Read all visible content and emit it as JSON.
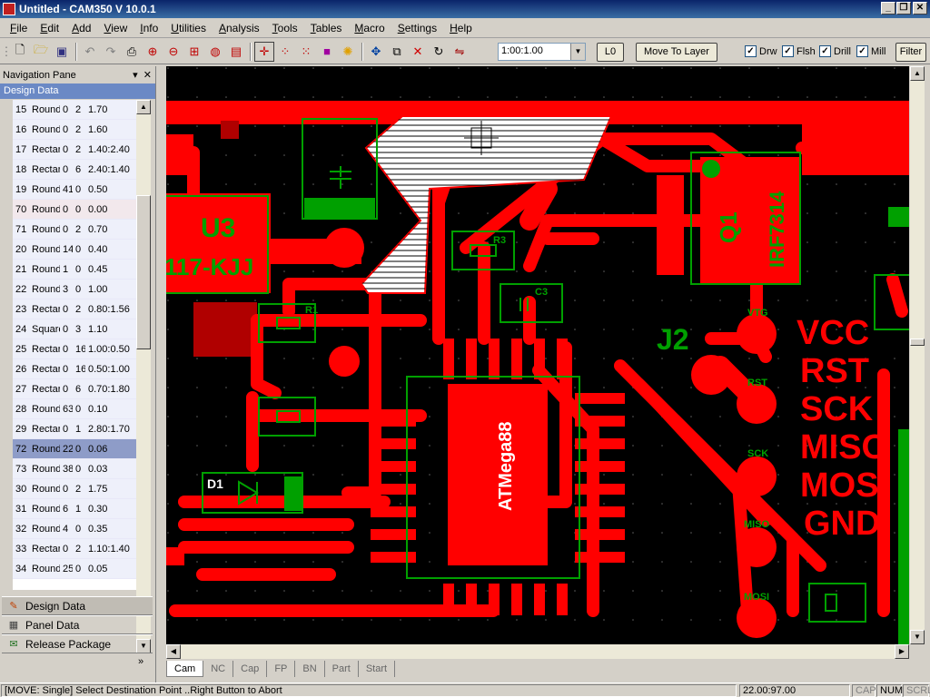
{
  "window": {
    "title": "Untitled - CAM350 V 10.0.1"
  },
  "window_controls": [
    "_",
    "❐",
    "✕"
  ],
  "menu": [
    "File",
    "Edit",
    "Add",
    "View",
    "Info",
    "Utilities",
    "Analysis",
    "Tools",
    "Tables",
    "Macro",
    "Settings",
    "Help"
  ],
  "toolbar": {
    "zoom_value": "1:00:1.00",
    "layer_button": "L0",
    "move_to_layer_button": "Move To Layer",
    "filter_button": "Filter",
    "checkboxes": [
      {
        "label": "Drw",
        "checked": true
      },
      {
        "label": "Flsh",
        "checked": true
      },
      {
        "label": "Drill",
        "checked": true
      },
      {
        "label": "Mill",
        "checked": true
      }
    ]
  },
  "nav_pane": {
    "title": "Navigation Pane",
    "section": "Design Data",
    "apertures": [
      {
        "id": "15",
        "shape": "Round",
        "a": "0",
        "b": "2",
        "size": "1.70"
      },
      {
        "id": "16",
        "shape": "Round",
        "a": "0",
        "b": "2",
        "size": "1.60"
      },
      {
        "id": "17",
        "shape": "Rectar",
        "a": "0",
        "b": "2",
        "size": "1.40:2.40"
      },
      {
        "id": "18",
        "shape": "Rectar",
        "a": "0",
        "b": "6",
        "size": "2.40:1.40"
      },
      {
        "id": "19",
        "shape": "Round",
        "a": "41",
        "b": "0",
        "size": "0.50"
      },
      {
        "id": "70",
        "shape": "Round",
        "a": "0",
        "b": "0",
        "size": "0.00"
      },
      {
        "id": "71",
        "shape": "Round",
        "a": "0",
        "b": "2",
        "size": "0.70"
      },
      {
        "id": "20",
        "shape": "Round",
        "a": "14",
        "b": "0",
        "size": "0.40"
      },
      {
        "id": "21",
        "shape": "Round",
        "a": "1",
        "b": "0",
        "size": "0.45"
      },
      {
        "id": "22",
        "shape": "Round",
        "a": "3",
        "b": "0",
        "size": "1.00"
      },
      {
        "id": "23",
        "shape": "Rectar",
        "a": "0",
        "b": "2",
        "size": "0.80:1.56"
      },
      {
        "id": "24",
        "shape": "Square",
        "a": "0",
        "b": "3",
        "size": "1.10"
      },
      {
        "id": "25",
        "shape": "Rectar",
        "a": "0",
        "b": "16",
        "size": "1.00:0.50"
      },
      {
        "id": "26",
        "shape": "Rectar",
        "a": "0",
        "b": "16",
        "size": "0.50:1.00"
      },
      {
        "id": "27",
        "shape": "Rectar",
        "a": "0",
        "b": "6",
        "size": "0.70:1.80"
      },
      {
        "id": "28",
        "shape": "Round",
        "a": "63",
        "b": "0",
        "size": "0.10"
      },
      {
        "id": "29",
        "shape": "Rectar",
        "a": "0",
        "b": "1",
        "size": "2.80:1.70"
      },
      {
        "id": "72",
        "shape": "Round",
        "a": "22",
        "b": "0",
        "size": "0.06"
      },
      {
        "id": "73",
        "shape": "Round",
        "a": "38",
        "b": "0",
        "size": "0.03"
      },
      {
        "id": "30",
        "shape": "Round",
        "a": "0",
        "b": "2",
        "size": "1.75"
      },
      {
        "id": "31",
        "shape": "Round",
        "a": "6",
        "b": "1",
        "size": "0.30"
      },
      {
        "id": "32",
        "shape": "Round",
        "a": "4",
        "b": "0",
        "size": "0.35"
      },
      {
        "id": "33",
        "shape": "Rectar",
        "a": "0",
        "b": "2",
        "size": "1.10:1.40"
      },
      {
        "id": "34",
        "shape": "Round",
        "a": "25",
        "b": "0",
        "size": "0.05"
      }
    ],
    "selected_row": "72",
    "buttons": [
      "Design Data",
      "Panel Data",
      "Release Package"
    ]
  },
  "board": {
    "labels": {
      "u3": "U3",
      "u3_part": "117-KJJ",
      "j2": "J2",
      "q1": "Q1",
      "q1_part": "IRF7314",
      "d1": "D1",
      "r3": "R3",
      "c3": "C3",
      "r1": "R1",
      "chip": "ATMega88",
      "pin_vtg": "VTG",
      "pin_rst": "RST",
      "pin_sck": "SCK",
      "pin_miso": "MISO",
      "pin_mosi": "MOSI",
      "sig_vcc": "VCC",
      "sig_rst": "RST",
      "sig_sck": "SCK",
      "sig_miso": "MISO",
      "sig_mosi": "MOSI",
      "sig_gnd": "GND"
    }
  },
  "tabs": [
    "Cam",
    "NC",
    "Cap",
    "FP",
    "BN",
    "Part",
    "Start"
  ],
  "active_tab": "Cam",
  "status": {
    "message": "[MOVE: Single] Select Destination Point ..Right Button to Abort",
    "coords": "22.00:97.00",
    "indicators": [
      "CAP",
      "NUM",
      "SCRL"
    ]
  },
  "colors": {
    "copper": "#ff0000",
    "silkscreen": "#00a000",
    "background": "#000000"
  }
}
